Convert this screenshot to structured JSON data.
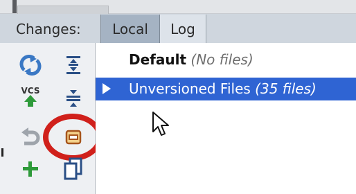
{
  "header": {
    "label": "Changes:"
  },
  "tabs": [
    {
      "label": "Local",
      "active": true
    },
    {
      "label": "Log",
      "active": false
    }
  ],
  "toolbar": {
    "vcs_label": "VCS",
    "icons": [
      "refresh-icon",
      "expand-all-icon",
      "commit-vcs-icon",
      "collapse-all-icon",
      "rollback-icon",
      "shelve-changes-icon",
      "add-changelist-icon",
      "copy-icon"
    ],
    "highlight_color": "#d0201b"
  },
  "tree": {
    "default": {
      "name": "Default",
      "meta": "(No files)"
    },
    "unversioned": {
      "name": "Unversioned Files",
      "meta": "(35 files)"
    }
  },
  "colors": {
    "selection": "#2f64d3",
    "active_tab": "#a5b3c3",
    "header_bg": "#cfd6de",
    "icon_blue": "#3a78c4",
    "icon_green": "#2e9a3a"
  }
}
